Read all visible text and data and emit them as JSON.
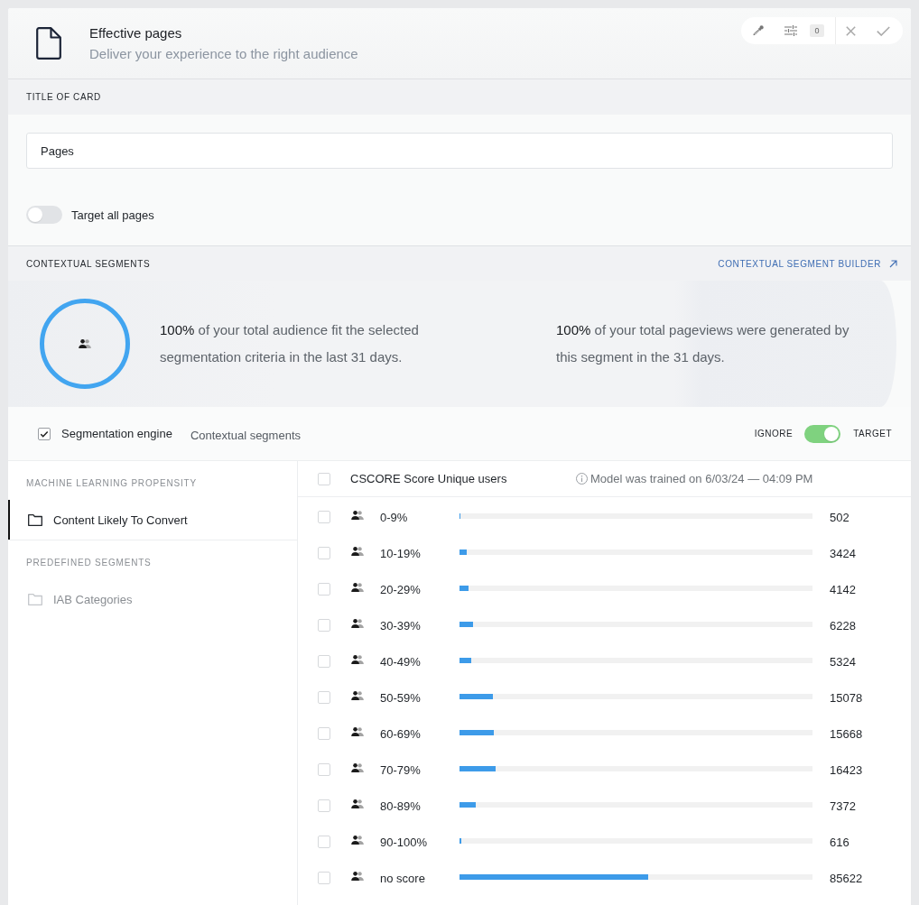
{
  "header": {
    "title": "Effective pages",
    "subtitle": "Deliver your experience to the right audience",
    "toolbar": {
      "badge": "0"
    }
  },
  "title_section": {
    "heading": "TITLE OF CARD",
    "field": {
      "value": "Pages"
    },
    "toggle": {
      "label": "Target all pages",
      "on": false
    }
  },
  "contextual_section": {
    "heading": "CONTEXTUAL SEGMENTS",
    "link": "CONTEXTUAL SEGMENT BUILDER",
    "summary": {
      "stats": [
        "**100%** of your total audience fit the selected segmentation criteria in the last 31 days.",
        "**100%** of your total pageviews were generated by this segment in the 31 days."
      ]
    },
    "engine": {
      "label": "Segmentation engine",
      "checked": true,
      "mode": "Contextual segments",
      "toggle": {
        "off_label": "IGNORE",
        "on_label": "TARGET",
        "on": true
      }
    }
  },
  "sidebar": {
    "groups": [
      {
        "heading": "MACHINE LEARNING PROPENSITY",
        "items": [
          {
            "label": "Content Likely To Convert",
            "selected": true
          }
        ]
      },
      {
        "heading": "PREDEFINED SEGMENTS",
        "items": [
          {
            "label": "IAB Categories",
            "selected": false
          }
        ]
      }
    ]
  },
  "table": {
    "header": {
      "label": "CSCORE Score Unique users",
      "checked": false,
      "note": "Model was trained on 6/03/24 — 04:09 PM"
    },
    "rows": [
      {
        "label": "0-9%",
        "checked": false,
        "level": 0.003,
        "count": "502"
      },
      {
        "label": "10-19%",
        "checked": false,
        "level": 0.021,
        "count": "3424"
      },
      {
        "label": "20-29%",
        "checked": false,
        "level": 0.026,
        "count": "4142"
      },
      {
        "label": "30-39%",
        "checked": false,
        "level": 0.039,
        "count": "6228"
      },
      {
        "label": "40-49%",
        "checked": false,
        "level": 0.033,
        "count": "5324"
      },
      {
        "label": "50-59%",
        "checked": false,
        "level": 0.094,
        "count": "15078"
      },
      {
        "label": "60-69%",
        "checked": false,
        "level": 0.098,
        "count": "15668"
      },
      {
        "label": "70-79%",
        "checked": false,
        "level": 0.102,
        "count": "16423"
      },
      {
        "label": "80-89%",
        "checked": false,
        "level": 0.046,
        "count": "7372"
      },
      {
        "label": "90-100%",
        "checked": false,
        "level": 0.004,
        "count": "616"
      },
      {
        "label": "no score",
        "checked": false,
        "level": 0.534,
        "count": "85622"
      }
    ]
  }
}
